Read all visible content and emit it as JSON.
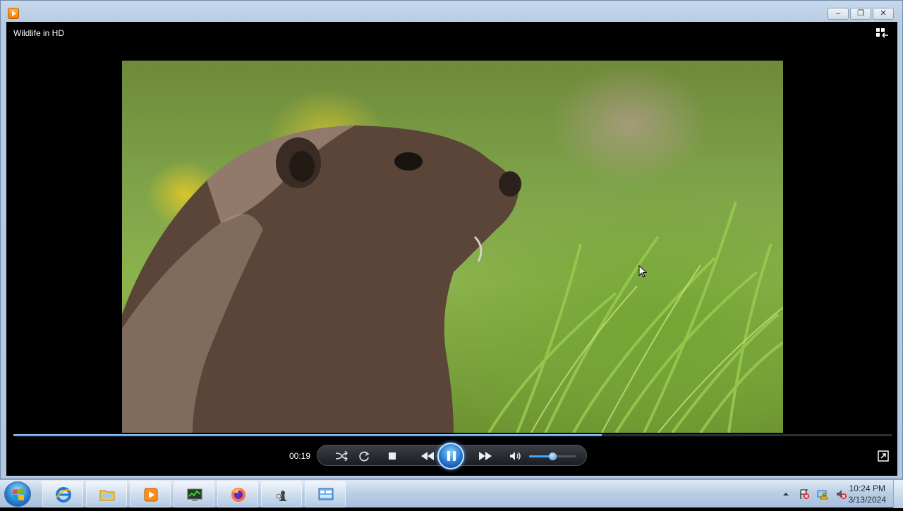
{
  "window": {
    "controls": {
      "minimize": "–",
      "restore": "❐",
      "close": "✕"
    },
    "app_icon": "media-player-icon"
  },
  "player": {
    "title": "Wildlife in HD",
    "elapsed": "00:19",
    "progress_fraction": 0.67,
    "volume_fraction": 0.5,
    "icons": [
      "shuffle-icon",
      "repeat-icon",
      "stop-icon",
      "previous-icon",
      "play-pause-icon",
      "next-icon",
      "volume-icon",
      "switch-to-library-icon",
      "fullscreen-icon"
    ]
  },
  "taskbar": {
    "pinned": [
      "internet-explorer-icon",
      "file-explorer-icon",
      "media-player-icon",
      "task-manager-icon",
      "firefox-icon",
      "chess-icon",
      "control-panel-icon"
    ],
    "clock_time": "10:24 PM",
    "clock_date": "3/13/2024"
  },
  "colors": {
    "accent": "#3b8ede",
    "taskbar": "#b9cde4"
  }
}
